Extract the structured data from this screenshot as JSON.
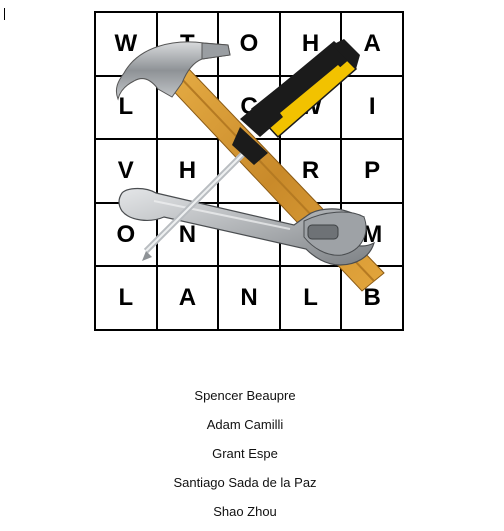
{
  "puzzle": {
    "rows": [
      [
        "W",
        "T",
        "O",
        "H",
        "A"
      ],
      [
        "L",
        "",
        "C",
        "W",
        "I"
      ],
      [
        "V",
        "H",
        "",
        "R",
        "P"
      ],
      [
        "O",
        "N",
        "",
        "",
        "M"
      ],
      [
        "L",
        "A",
        "N",
        "L",
        "B"
      ]
    ]
  },
  "illustration": {
    "icons": [
      "hammer-icon",
      "screwdriver-icon",
      "wrench-icon"
    ],
    "colors": {
      "hammer_handle": "#d99a2b",
      "screwdriver_handle": "#f2c200",
      "metal": "#a9adb1"
    }
  },
  "names": [
    "Spencer Beaupre",
    "Adam Camilli",
    "Grant Espe",
    "Santiago Sada de la Paz",
    "Shao Zhou"
  ]
}
